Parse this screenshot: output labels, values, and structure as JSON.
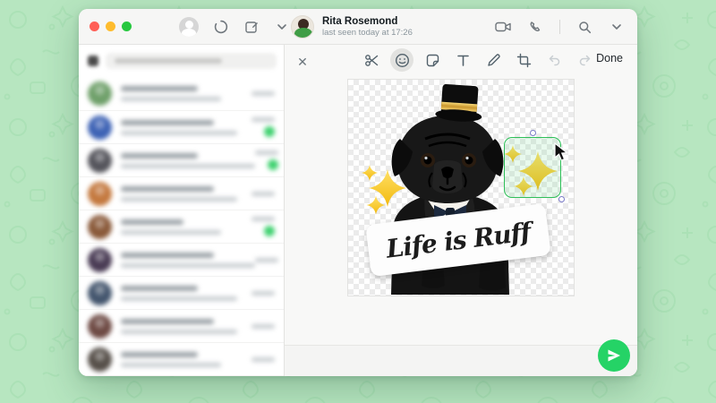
{
  "titlebar": {
    "contact": {
      "name": "Rita Rosemond",
      "status": "last seen today at 17:26"
    }
  },
  "editor": {
    "done_label": "Done",
    "close_label": "✕",
    "tools": [
      "cut",
      "emoji",
      "sticker",
      "text",
      "draw",
      "crop",
      "undo",
      "redo"
    ],
    "selected_tool": "emoji",
    "disabled_tools": [
      "undo",
      "redo"
    ],
    "sticker_caption": "Life is Ruff"
  },
  "colors": {
    "whatsapp_green": "#25d366",
    "selection_green": "#2fbf59",
    "background_green": "#b7e6c0",
    "sparkle_gold": "#f6c51d",
    "unread_badge": "#3ed16f"
  },
  "sidebar": {
    "chats": [
      {
        "avatar_color": "#6fa06a",
        "unread_badge": false
      },
      {
        "avatar_color": "#3e63b5",
        "unread_badge": true
      },
      {
        "avatar_color": "#55555c",
        "unread_badge": true
      },
      {
        "avatar_color": "#c4793f",
        "unread_badge": false
      },
      {
        "avatar_color": "#8a5a3a",
        "unread_badge": true
      },
      {
        "avatar_color": "#4a3c55",
        "unread_badge": false
      },
      {
        "avatar_color": "#44566e",
        "unread_badge": false
      },
      {
        "avatar_color": "#6e4a44",
        "unread_badge": false
      },
      {
        "avatar_color": "#57504a",
        "unread_badge": false
      },
      {
        "avatar_color": "#3a3a3a",
        "unread_badge": false
      }
    ]
  }
}
